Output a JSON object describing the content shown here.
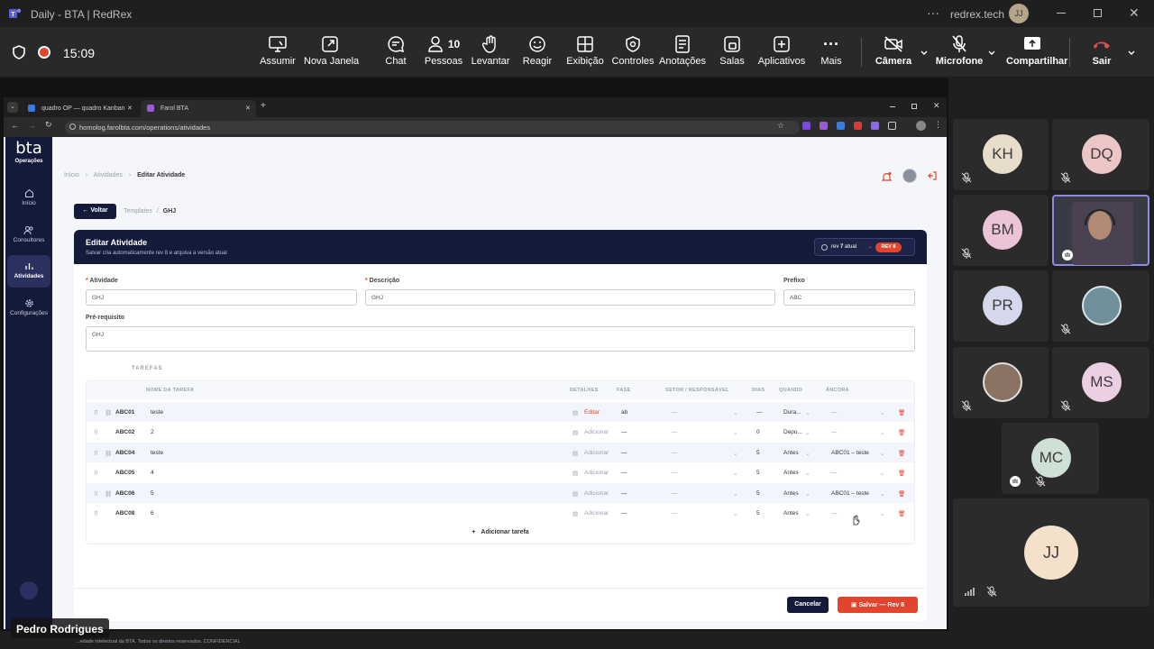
{
  "window": {
    "title": "Daily - BTA | RedRex",
    "org": "redrex.tech",
    "user_initials": "JJ"
  },
  "meeting": {
    "time": "15:09",
    "toolbar": {
      "take_control": "Assumir",
      "new_window": "Nova Janela",
      "chat": "Chat",
      "people": "Pessoas",
      "people_count": "10",
      "raise": "Levantar",
      "react": "Reagir",
      "view": "Exibição",
      "controls": "Controles",
      "notes": "Anotações",
      "rooms": "Salas",
      "apps": "Aplicativos",
      "more": "Mais",
      "camera": "Câmera",
      "mic": "Microfone",
      "share": "Compartilhar",
      "leave": "Sair"
    },
    "presenter_name": "Pedro Rodrigues"
  },
  "browser": {
    "tabs": [
      "quadro OP — quadro Kanban",
      "Farol BTA"
    ],
    "url": "homolog.farolbta.com/operations/atividades"
  },
  "app": {
    "logo": "bta",
    "logo_sub": "Operações",
    "nav": [
      "Início",
      "Consultores",
      "Atividades",
      "Configurações"
    ],
    "breadcrumb": {
      "home": "Início",
      "section": "Atividades",
      "current": "Editar Atividade"
    },
    "back_button": "Voltar",
    "sub_breadcrumb": {
      "templates": "Templates",
      "sep": "/",
      "current": "GHJ"
    },
    "card": {
      "title": "Editar Atividade",
      "subtitle": "Salvar cria automaticamente rev 8 e arquiva a versão atual",
      "rev_prefix": "rev",
      "rev_current_num": "7",
      "rev_current_suffix": "atual",
      "rev_arrow": "→",
      "rev_new": "REV 8"
    },
    "form": {
      "activity_label": "Atividade",
      "activity_value": "GHJ",
      "description_label": "Descrição",
      "description_value": "GHJ",
      "prefix_label": "Prefixo",
      "prefix_value": "ABC",
      "prereq_label": "Pré-requisito",
      "prereq_value": "GHJ"
    },
    "tasks": {
      "section_title": "TAREFAS",
      "headers": [
        "NOME DA TAREFA",
        "DETALHES",
        "FASE",
        "SETOR / RESPONSÁVEL",
        "DIAS",
        "QUANDO",
        "ÂNCORA"
      ],
      "rows": [
        {
          "code": "ABC01",
          "name": "teste",
          "details": "Editar",
          "phase": "ab",
          "sector": "—",
          "days": "—",
          "when": "Dura...",
          "anchor": "—",
          "link": true
        },
        {
          "code": "ABC02",
          "name": "2",
          "details": "Adicionar",
          "phase": "—",
          "sector": "—",
          "days": "0",
          "when": "Depo...",
          "anchor": "—",
          "link": false
        },
        {
          "code": "ABC04",
          "name": "teste",
          "details": "Adicionar",
          "phase": "—",
          "sector": "—",
          "days": "5",
          "when": "Antes",
          "anchor": "ABC01 – teste",
          "link": true
        },
        {
          "code": "ABC05",
          "name": "4",
          "details": "Adicionar",
          "phase": "—",
          "sector": "—",
          "days": "5",
          "when": "Antes",
          "anchor": "—",
          "link": false
        },
        {
          "code": "ABC06",
          "name": "5",
          "details": "Adicionar",
          "phase": "—",
          "sector": "—",
          "days": "5",
          "when": "Antes",
          "anchor": "ABC01 – teste",
          "link": true
        },
        {
          "code": "ABC08",
          "name": "6",
          "details": "Adicionar",
          "phase": "—",
          "sector": "—",
          "days": "5",
          "when": "Antes",
          "anchor": "—",
          "link": false
        }
      ],
      "add_task": "Adicionar tarefa"
    },
    "cancel_button": "Cancelar",
    "save_button": "Salvar — Rev 8",
    "footer": "...edade intelectual da BTA. Todos os direitos reservados. CONFIDENCIAL"
  },
  "participants": [
    {
      "initials": "KH",
      "color": "#e8dccb"
    },
    {
      "initials": "DQ",
      "color": "#ecc6c6"
    },
    {
      "initials": "BM",
      "color": "#ecc4d8"
    },
    {
      "initials": "PR",
      "color": "#d6d9ec"
    },
    {
      "initials": "MS",
      "color": "#ead0e2"
    },
    {
      "initials": "MC",
      "color": "#cfe0d6"
    },
    {
      "initials": "JJ",
      "color": "#f3e1c9"
    }
  ],
  "colors": {
    "accent": "#e2452e",
    "navy": "#141a3a",
    "speaker_border": "#8e8ae6"
  }
}
